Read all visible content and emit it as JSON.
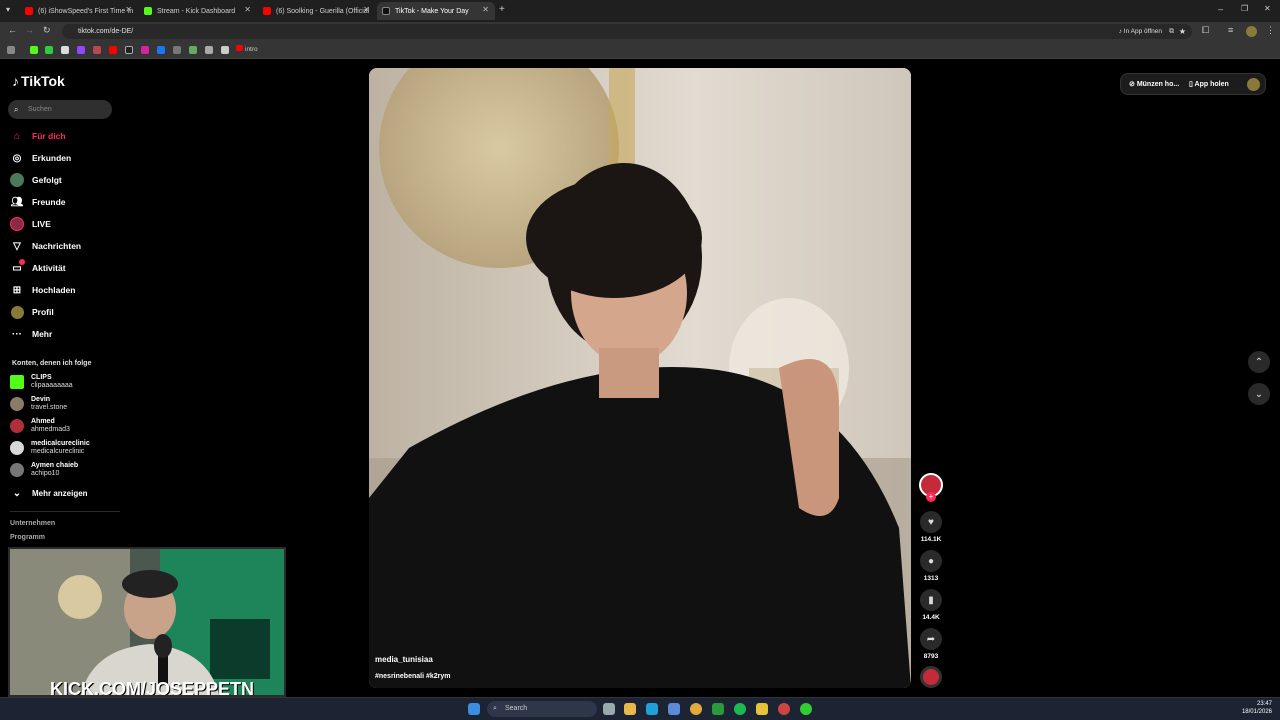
{
  "browser": {
    "tabs": [
      {
        "label": "(6) iShowSpeed's First Time In",
        "color": "#ff0000"
      },
      {
        "label": "Stream - Kick Dashboard",
        "color": "#53fc18"
      },
      {
        "label": "(6) Soolking - Guerilla (Official",
        "color": "#ff0000"
      },
      {
        "label": "TikTok - Make Your Day",
        "color": "#ffffff"
      }
    ],
    "url": "tiktok.com/de-DE/",
    "in_app_label": "In App öffnen",
    "bookmark_intro": "intro"
  },
  "sidebar": {
    "logo": "TikTok",
    "search_placeholder": "Suchen",
    "nav": [
      {
        "label": "Für dich",
        "icon": "home-icon"
      },
      {
        "label": "Erkunden",
        "icon": "compass-icon"
      },
      {
        "label": "Gefolgt",
        "icon": "following-icon"
      },
      {
        "label": "Freunde",
        "icon": "friends-icon"
      },
      {
        "label": "LIVE",
        "icon": "live-icon"
      },
      {
        "label": "Nachrichten",
        "icon": "messages-icon"
      },
      {
        "label": "Aktivität",
        "icon": "activity-icon"
      },
      {
        "label": "Hochladen",
        "icon": "upload-icon"
      },
      {
        "label": "Profil",
        "icon": "profile-icon"
      },
      {
        "label": "Mehr",
        "icon": "more-icon"
      }
    ],
    "following_title": "Konten, denen ich folge",
    "accounts": [
      {
        "name": "CLIPS",
        "handle": "clipaaaaaaaa",
        "color": "#53fc18"
      },
      {
        "name": "Devin",
        "handle": "travel.stone",
        "color": "#8a7a6a"
      },
      {
        "name": "Ahmed",
        "handle": "ahmedmad3",
        "color": "#b0303a"
      },
      {
        "name": "medicalcureclinic",
        "handle": "medicalcureclinic",
        "color": "#d8d8d8"
      },
      {
        "name": "Aymen chaieb",
        "handle": "achipo10",
        "color": "#777777"
      }
    ],
    "show_more": "Mehr anzeigen",
    "footer": [
      "Unternehmen",
      "Programm"
    ]
  },
  "video": {
    "author": "media_tunisiaa",
    "tags": "#nesrinebenali #k2rym"
  },
  "actions": {
    "likes": "114.1K",
    "comments": "1313",
    "saves": "14.4K",
    "shares": "8793"
  },
  "topright": {
    "coins": "Münzen ho...",
    "get_app": "App holen"
  },
  "webcam": {
    "overlay": "KICK.COM/JOSEPPETN"
  },
  "taskbar": {
    "search_placeholder": "Search",
    "time": "23:47",
    "date": "18/01/2026"
  }
}
